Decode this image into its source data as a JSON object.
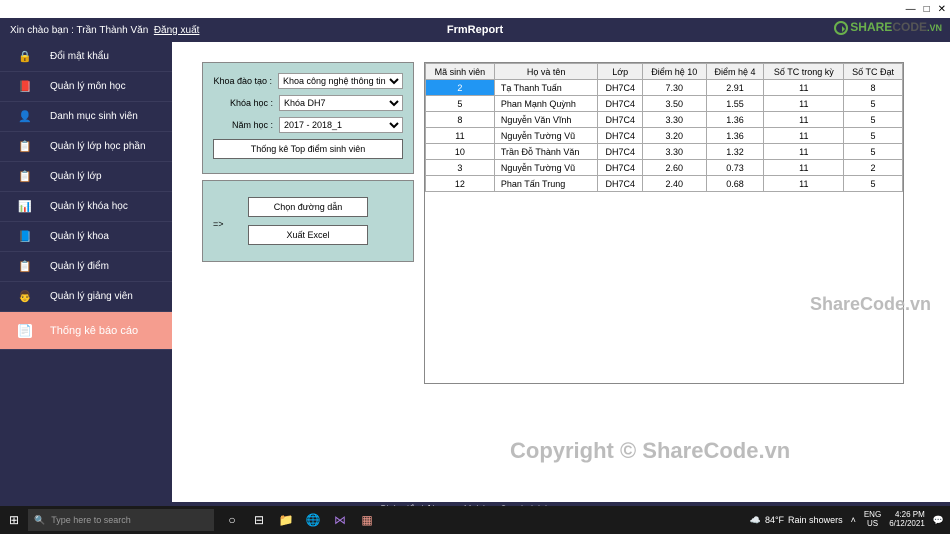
{
  "titlebar": {
    "min": "—",
    "max": "□",
    "close": "✕"
  },
  "header": {
    "greeting_prefix": "Xin chào bạn : ",
    "username": "Trần Thành Văn",
    "logout": "Đăng xuất",
    "window_title": "FrmReport",
    "logo1": "SHARE",
    "logo2": "CODE",
    "logo3": ".VN"
  },
  "sidebar": {
    "items": [
      {
        "icon": "🔒",
        "label": "Đổi mật khẩu"
      },
      {
        "icon": "📕",
        "label": "Quản lý môn học"
      },
      {
        "icon": "👤",
        "label": "Danh mục sinh viên"
      },
      {
        "icon": "📋",
        "label": "Quản lý lớp học phần"
      },
      {
        "icon": "📋",
        "label": "Quản lý lớp"
      },
      {
        "icon": "📊",
        "label": "Quản lý khóa học"
      },
      {
        "icon": "📘",
        "label": "Quản lý khoa"
      },
      {
        "icon": "📋",
        "label": "Quản lý điểm"
      },
      {
        "icon": "👨",
        "label": "Quản lý giảng viên"
      },
      {
        "icon": "📄",
        "label": "Thống kê báo cáo"
      }
    ]
  },
  "form": {
    "labels": {
      "khoa": "Khoa đào tạo :",
      "khoahoc": "Khóa học :",
      "namhoc": "Năm học :"
    },
    "values": {
      "khoa": "Khoa công nghệ thông tin",
      "khoahoc": "Khóa DH7",
      "namhoc": "2017 - 2018_1"
    },
    "btn_top": "Thống kê Top điểm sinh viên",
    "btn_path": "Chọn đường dẫn",
    "arrow": "=>",
    "btn_excel": "Xuất Excel"
  },
  "table": {
    "headers": [
      "Mã sinh viên",
      "Họ và tên",
      "Lớp",
      "Điểm hệ 10",
      "Điểm hệ 4",
      "Số TC trong kỳ",
      "Số TC Đạt"
    ],
    "rows": [
      [
        "2",
        "Tạ Thanh Tuấn",
        "DH7C4",
        "7.30",
        "2.91",
        "11",
        "8"
      ],
      [
        "5",
        "Phan Mạnh Quỳnh",
        "DH7C4",
        "3.50",
        "1.55",
        "11",
        "5"
      ],
      [
        "8",
        "Nguyễn Văn Vĩnh",
        "DH7C4",
        "3.30",
        "1.36",
        "11",
        "5"
      ],
      [
        "11",
        "Nguyễn Tường Vũ",
        "DH7C4",
        "3.20",
        "1.36",
        "11",
        "5"
      ],
      [
        "10",
        "Trần Đỗ Thành Văn",
        "DH7C4",
        "3.30",
        "1.32",
        "11",
        "5"
      ],
      [
        "3",
        "Nguyễn Tường Vũ",
        "DH7C4",
        "2.60",
        "0.73",
        "11",
        "2"
      ],
      [
        "12",
        "Phan Tấn Trung",
        "DH7C4",
        "2.40",
        "0.68",
        "11",
        "5"
      ]
    ]
  },
  "watermarks": {
    "wm1": "ShareCode.vn",
    "wm2": "Copyright © ShareCode.vn"
  },
  "footer": "Phát triển bởi - www.Moichan.Sanchoigioitre.vn",
  "taskbar": {
    "search_placeholder": "Type here to search",
    "weather_temp": "84°F",
    "weather_text": "Rain showers",
    "lang1": "ENG",
    "lang2": "US",
    "time": "4:26 PM",
    "date": "6/12/2021"
  }
}
